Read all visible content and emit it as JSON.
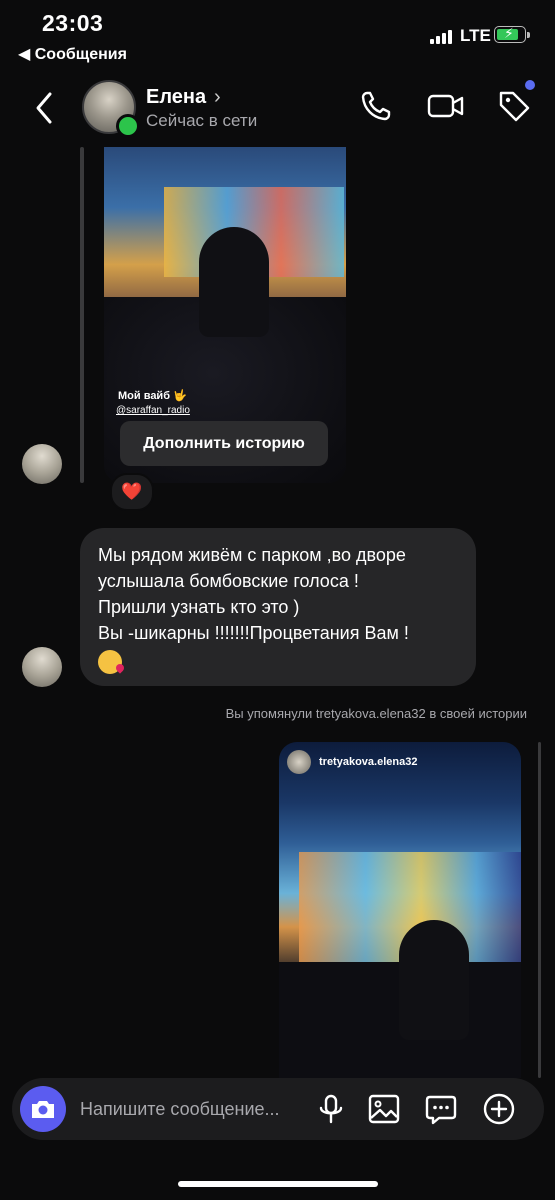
{
  "status_bar": {
    "time": "23:03",
    "back_app": "◀ Сообщения",
    "network": "LTE"
  },
  "header": {
    "name": "Елена",
    "status": "Сейчас в сети",
    "online_color": "#2cc44b"
  },
  "messages": [
    {
      "type": "story_reply",
      "caption": "Мой вайб 🤟",
      "handle": "@saraffan_radio",
      "add_story_label": "Дополнить историю",
      "reaction": "❤️"
    },
    {
      "type": "text",
      "lines": [
        "Мы рядом живём с парком ,во дворе",
        "услышала бомбовские голоса !",
        "Пришли узнать кто это )",
        "Вы -шикарны !!!!!!!Процветания Вам !"
      ]
    },
    {
      "type": "mention_note",
      "text": "Вы упомянули tretyakova.elena32 в своей истории"
    },
    {
      "type": "story_sent",
      "author": "tretyakova.elena32"
    }
  ],
  "composer": {
    "placeholder": "Напишите сообщение..."
  },
  "colors": {
    "accent": "#5b5cf0",
    "bubble": "#262628",
    "background": "#0b0b0c"
  }
}
